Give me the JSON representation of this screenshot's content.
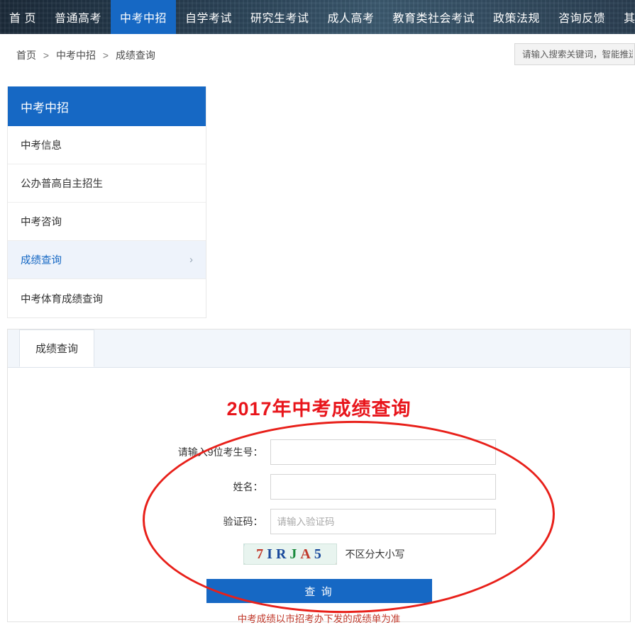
{
  "topnav": {
    "items": [
      {
        "label": "首 页",
        "active": false
      },
      {
        "label": "普通高考",
        "active": false
      },
      {
        "label": "中考中招",
        "active": true
      },
      {
        "label": "自学考试",
        "active": false
      },
      {
        "label": "研究生考试",
        "active": false
      },
      {
        "label": "成人高考",
        "active": false
      },
      {
        "label": "教育类社会考试",
        "active": false
      },
      {
        "label": "政策法规",
        "active": false
      },
      {
        "label": "咨询反馈",
        "active": false
      },
      {
        "label": "其他",
        "active": false
      }
    ]
  },
  "search": {
    "placeholder": "请输入搜索关键词，智能推送"
  },
  "breadcrumb": {
    "items": [
      "首页",
      "中考中招",
      "成绩查询"
    ],
    "separator": ">"
  },
  "sidebar": {
    "title": "中考中招",
    "items": [
      {
        "label": "中考信息",
        "selected": false,
        "arrow": ""
      },
      {
        "label": "公办普高自主招生",
        "selected": false,
        "arrow": ""
      },
      {
        "label": "中考咨询",
        "selected": false,
        "arrow": ""
      },
      {
        "label": "成绩查询",
        "selected": true,
        "arrow": "›"
      },
      {
        "label": "中考体育成绩查询",
        "selected": false,
        "arrow": ""
      }
    ]
  },
  "panel": {
    "tab_label": "成绩查询",
    "form": {
      "title": "2017年中考成绩查询",
      "fields": [
        {
          "label": "请输入9位考生号：",
          "value": "",
          "placeholder": ""
        },
        {
          "label": "姓名：",
          "value": "",
          "placeholder": ""
        },
        {
          "label": "验证码：",
          "value": "",
          "placeholder": "请输入验证码"
        }
      ],
      "captcha": {
        "chars": [
          {
            "ch": "7",
            "color": "#c0392b"
          },
          {
            "ch": "I",
            "color": "#1a4a9c"
          },
          {
            "ch": "R",
            "color": "#1a4a9c"
          },
          {
            "ch": "J",
            "color": "#1a8a3c"
          },
          {
            "ch": "A",
            "color": "#c0392b"
          },
          {
            "ch": "5",
            "color": "#1a4a9c"
          }
        ],
        "note": "不区分大小写"
      },
      "submit_label": "查 询",
      "footnote": "中考成绩以市招考办下发的成绩单为准"
    }
  },
  "colors": {
    "brand_blue": "#1668c4",
    "annotation_red": "#e8201a",
    "title_red": "#e8151b"
  }
}
